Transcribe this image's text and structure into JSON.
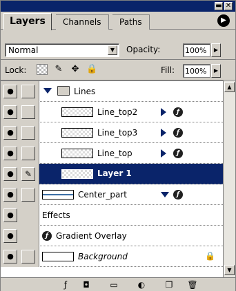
{
  "tabs": [
    {
      "label": "Layers",
      "active": true
    },
    {
      "label": "Channels",
      "active": false
    },
    {
      "label": "Paths",
      "active": false
    }
  ],
  "titlebar": {
    "minimize_glyph": "▬",
    "close_glyph": "✕",
    "menu_glyph": "▶"
  },
  "blend_mode": "Normal",
  "opacity": {
    "label": "Opacity:",
    "value": "100%"
  },
  "lock": {
    "label": "Lock:"
  },
  "fill": {
    "label": "Fill:",
    "value": "100%"
  },
  "layers": [
    {
      "name": "Lines",
      "type": "group",
      "visible": true
    },
    {
      "name": "Line_top2",
      "type": "layer",
      "visible": true,
      "has_effects": true
    },
    {
      "name": "Line_top3",
      "type": "layer",
      "visible": true,
      "has_effects": true
    },
    {
      "name": "Line_top",
      "type": "layer",
      "visible": true,
      "has_effects": true
    },
    {
      "name": "Layer 1",
      "type": "layer",
      "visible": true,
      "selected": true,
      "brush": true
    },
    {
      "name": "Center_part",
      "type": "layer",
      "visible": true,
      "has_effects": true
    },
    {
      "name": "Effects",
      "type": "effects-header"
    },
    {
      "name": "Gradient Overlay",
      "type": "effect"
    },
    {
      "name": "Background",
      "type": "background",
      "visible": true,
      "locked": true
    }
  ],
  "colors": {
    "selected": "#0a246a",
    "panel": "#d4d0c8"
  }
}
